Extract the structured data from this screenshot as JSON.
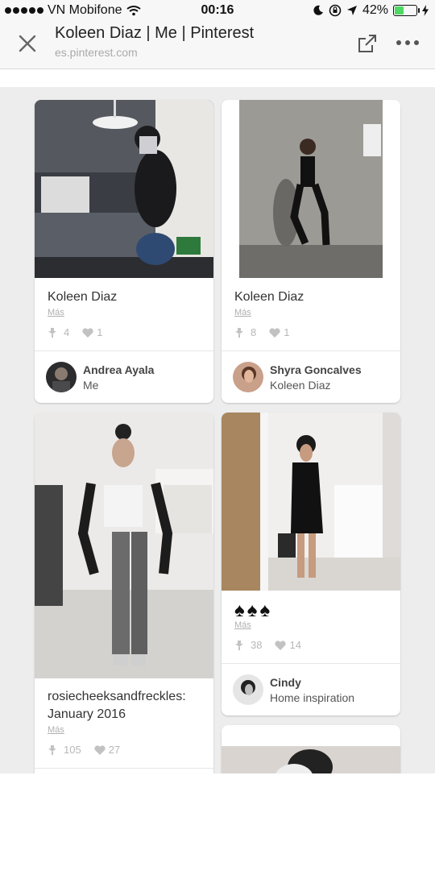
{
  "status_bar": {
    "carrier": "VN Mobifone",
    "time": "00:16",
    "battery": "42%",
    "battery_level": 0.42
  },
  "browser": {
    "title": "Koleen Diaz | Me | Pinterest",
    "url": "es.pinterest.com"
  },
  "pins": [
    {
      "title": "Koleen Diaz",
      "more": "Más",
      "repins": "4",
      "likes": "1",
      "user": "Andrea Ayala",
      "board": "Me"
    },
    {
      "title": "Koleen Diaz",
      "more": "Más",
      "repins": "8",
      "likes": "1",
      "user": "Shyra Goncalves",
      "board": "Koleen Diaz"
    },
    {
      "title_line1": "rosiecheeksandfreckles:",
      "title_line2": "January 2016",
      "more": "Más",
      "repins": "105",
      "likes": "27"
    },
    {
      "title": "♠♠♠",
      "more": "Más",
      "repins": "38",
      "likes": "14",
      "user": "Cindy",
      "board": "Home inspiration"
    }
  ],
  "colors": {
    "page_bg": "#ededed",
    "card_bg": "#ffffff",
    "meta_text": "#b7b7b7",
    "battery_fill": "#4cd964"
  }
}
